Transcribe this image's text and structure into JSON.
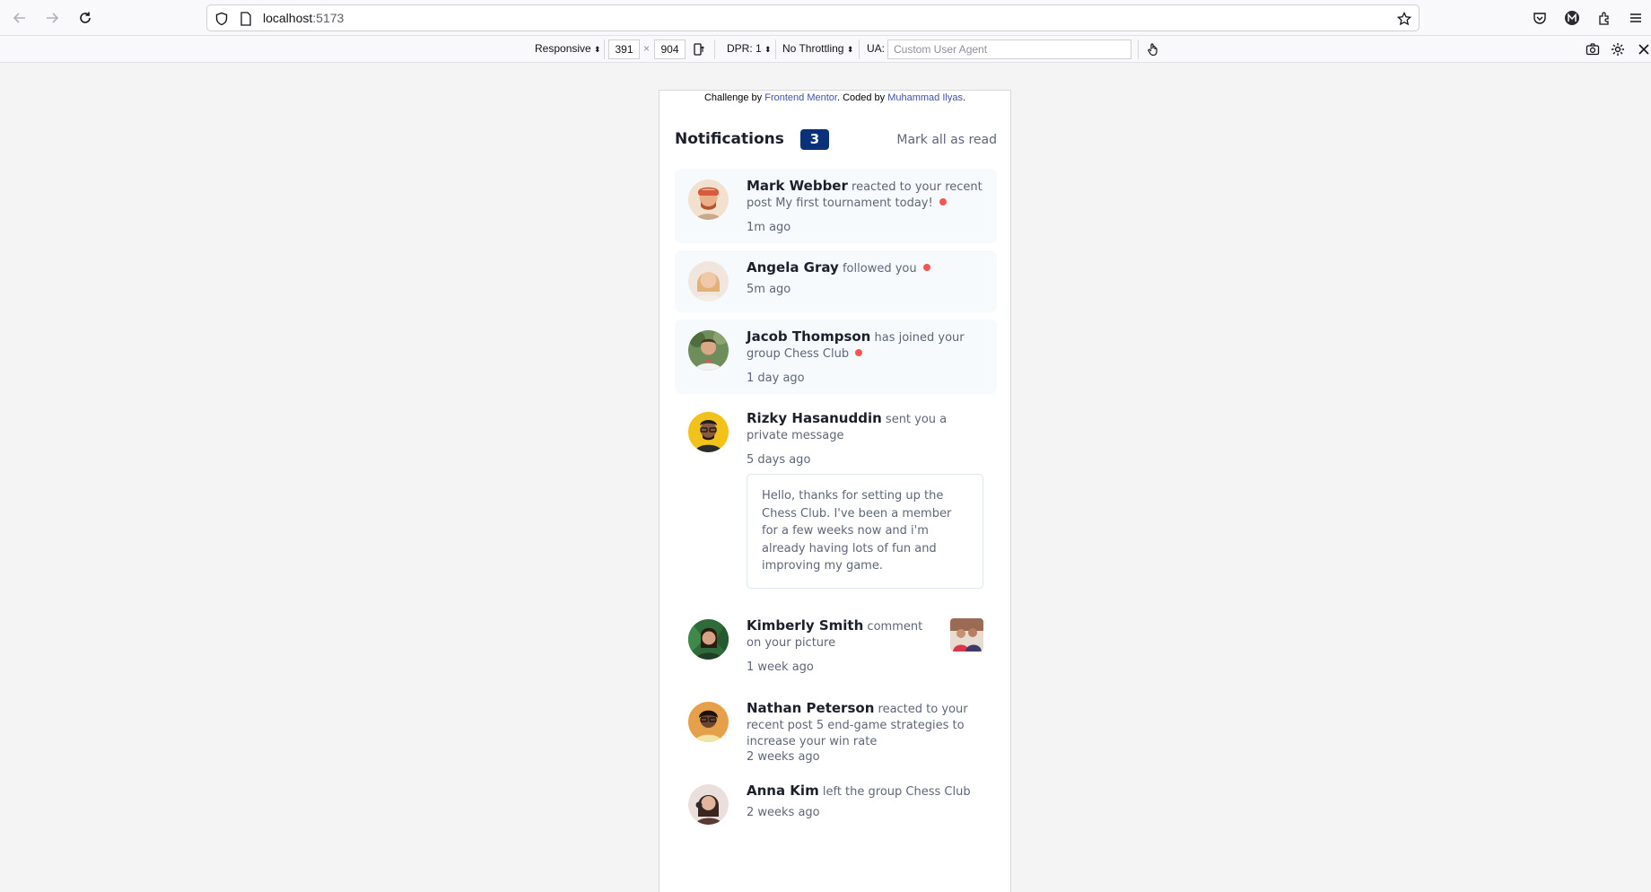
{
  "browser": {
    "url_host": "localhost",
    "url_port": ":5173"
  },
  "rdm": {
    "device": "Responsive",
    "width": "391",
    "times": "×",
    "height": "904",
    "dpr": "DPR: 1",
    "throttling": "No Throttling",
    "ua_label": "UA:",
    "ua_placeholder": "Custom User Agent"
  },
  "attribution": {
    "prefix": "Challenge by ",
    "challenge_link": "Frontend Mentor",
    "middle": ". Coded by ",
    "author_link": "Muhammad Ilyas",
    "suffix": "."
  },
  "header": {
    "title": "Notifications",
    "unread_count": "3",
    "mark_all": "Mark all as read"
  },
  "notifications": [
    {
      "user": "Mark Webber",
      "action": "reacted to your recent post",
      "object": "My first tournament today!",
      "time": "1m ago",
      "unread": true
    },
    {
      "user": "Angela Gray",
      "action": "followed you",
      "object": "",
      "time": "5m ago",
      "unread": true
    },
    {
      "user": "Jacob Thompson",
      "action": "has joined your group",
      "object": "Chess Club",
      "time": "1 day ago",
      "unread": true
    },
    {
      "user": "Rizky Hasanuddin",
      "action": "sent you a private message",
      "object": "",
      "time": "5 days ago",
      "unread": false,
      "message": "Hello, thanks for setting up the Chess Club. I've been a member for a few weeks now and i'm already having lots of fun and improving my game."
    },
    {
      "user": "Kimberly Smith",
      "action": "comment on your picture",
      "object": "",
      "time": "1 week ago",
      "unread": false
    },
    {
      "user": "Nathan Peterson",
      "action": "reacted to your recent post",
      "object": "5 end-game strategies to increase your win rate",
      "time": "2 weeks ago",
      "unread": false
    },
    {
      "user": "Anna Kim",
      "action": "left the group",
      "object": "Chess Club",
      "time": "2 weeks ago",
      "unread": false
    }
  ],
  "colors": {
    "badge": "#0a327b",
    "unread_dot": "#f65552",
    "unread_bg": "#f7fafd",
    "link": "#3e52a3"
  }
}
